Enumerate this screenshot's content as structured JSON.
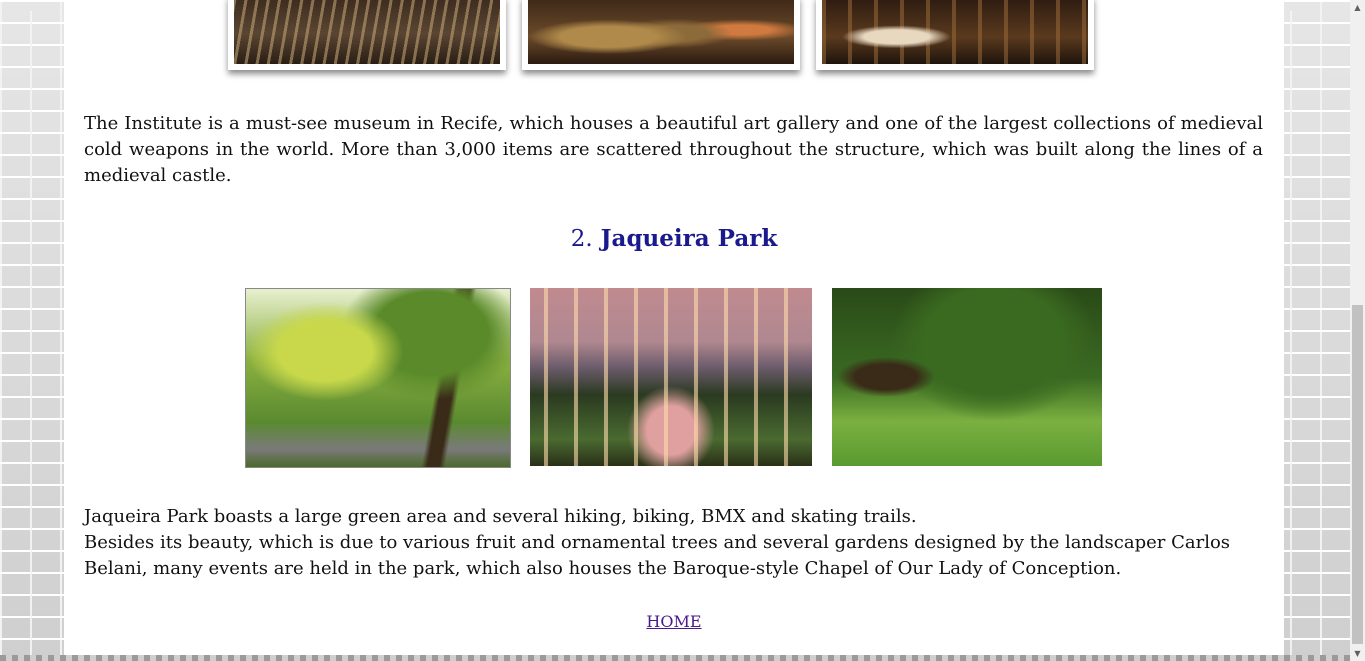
{
  "section_1": {
    "description": "The Institute is a must-see museum in Recife, which houses a beautiful art gallery and one of the largest collections of medieval cold weapons in the world. More than 3,000 items are scattered throughout the structure, which was built along the lines of a medieval castle."
  },
  "section_2": {
    "number": "2.",
    "title": "Jaqueira Park",
    "description_line_1": "Jaqueira Park boasts a large green area and several hiking, biking, BMX and skating trails.",
    "description_line_2": "Besides its beauty, which is due to various fruit and ornamental trees and several gardens designed by the landscaper Carlos Belani, many events are held in the park, which also houses the Baroque-style Chapel of Our Lady of Conception."
  },
  "footer": {
    "home_link": "HOME"
  },
  "colors": {
    "heading": "#1a1a8c",
    "link": "#4a1a8c",
    "page_background": "#ffffff"
  },
  "scrollbar": {
    "up_icon": "triangle-up",
    "down_icon": "triangle-down"
  }
}
